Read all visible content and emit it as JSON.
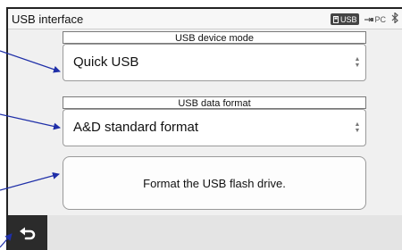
{
  "window": {
    "title": "USB interface",
    "status": {
      "usb_badge": "USB",
      "pc_label": "PC",
      "bluetooth_icon": "bluetooth-icon"
    }
  },
  "device_mode": {
    "label": "USB device mode",
    "value": "Quick USB"
  },
  "data_format": {
    "label": "USB data format",
    "value": "A&D standard format"
  },
  "format_button": {
    "label": "Format the USB flash drive."
  },
  "footer": {
    "back_icon": "back-arrow-icon"
  },
  "colors": {
    "annotation_arrow": "#1f2fa8",
    "screen_bg": "#f0f0f0",
    "footer_bg": "#e4e4e4",
    "back_button_bg": "#2b2b2b"
  }
}
